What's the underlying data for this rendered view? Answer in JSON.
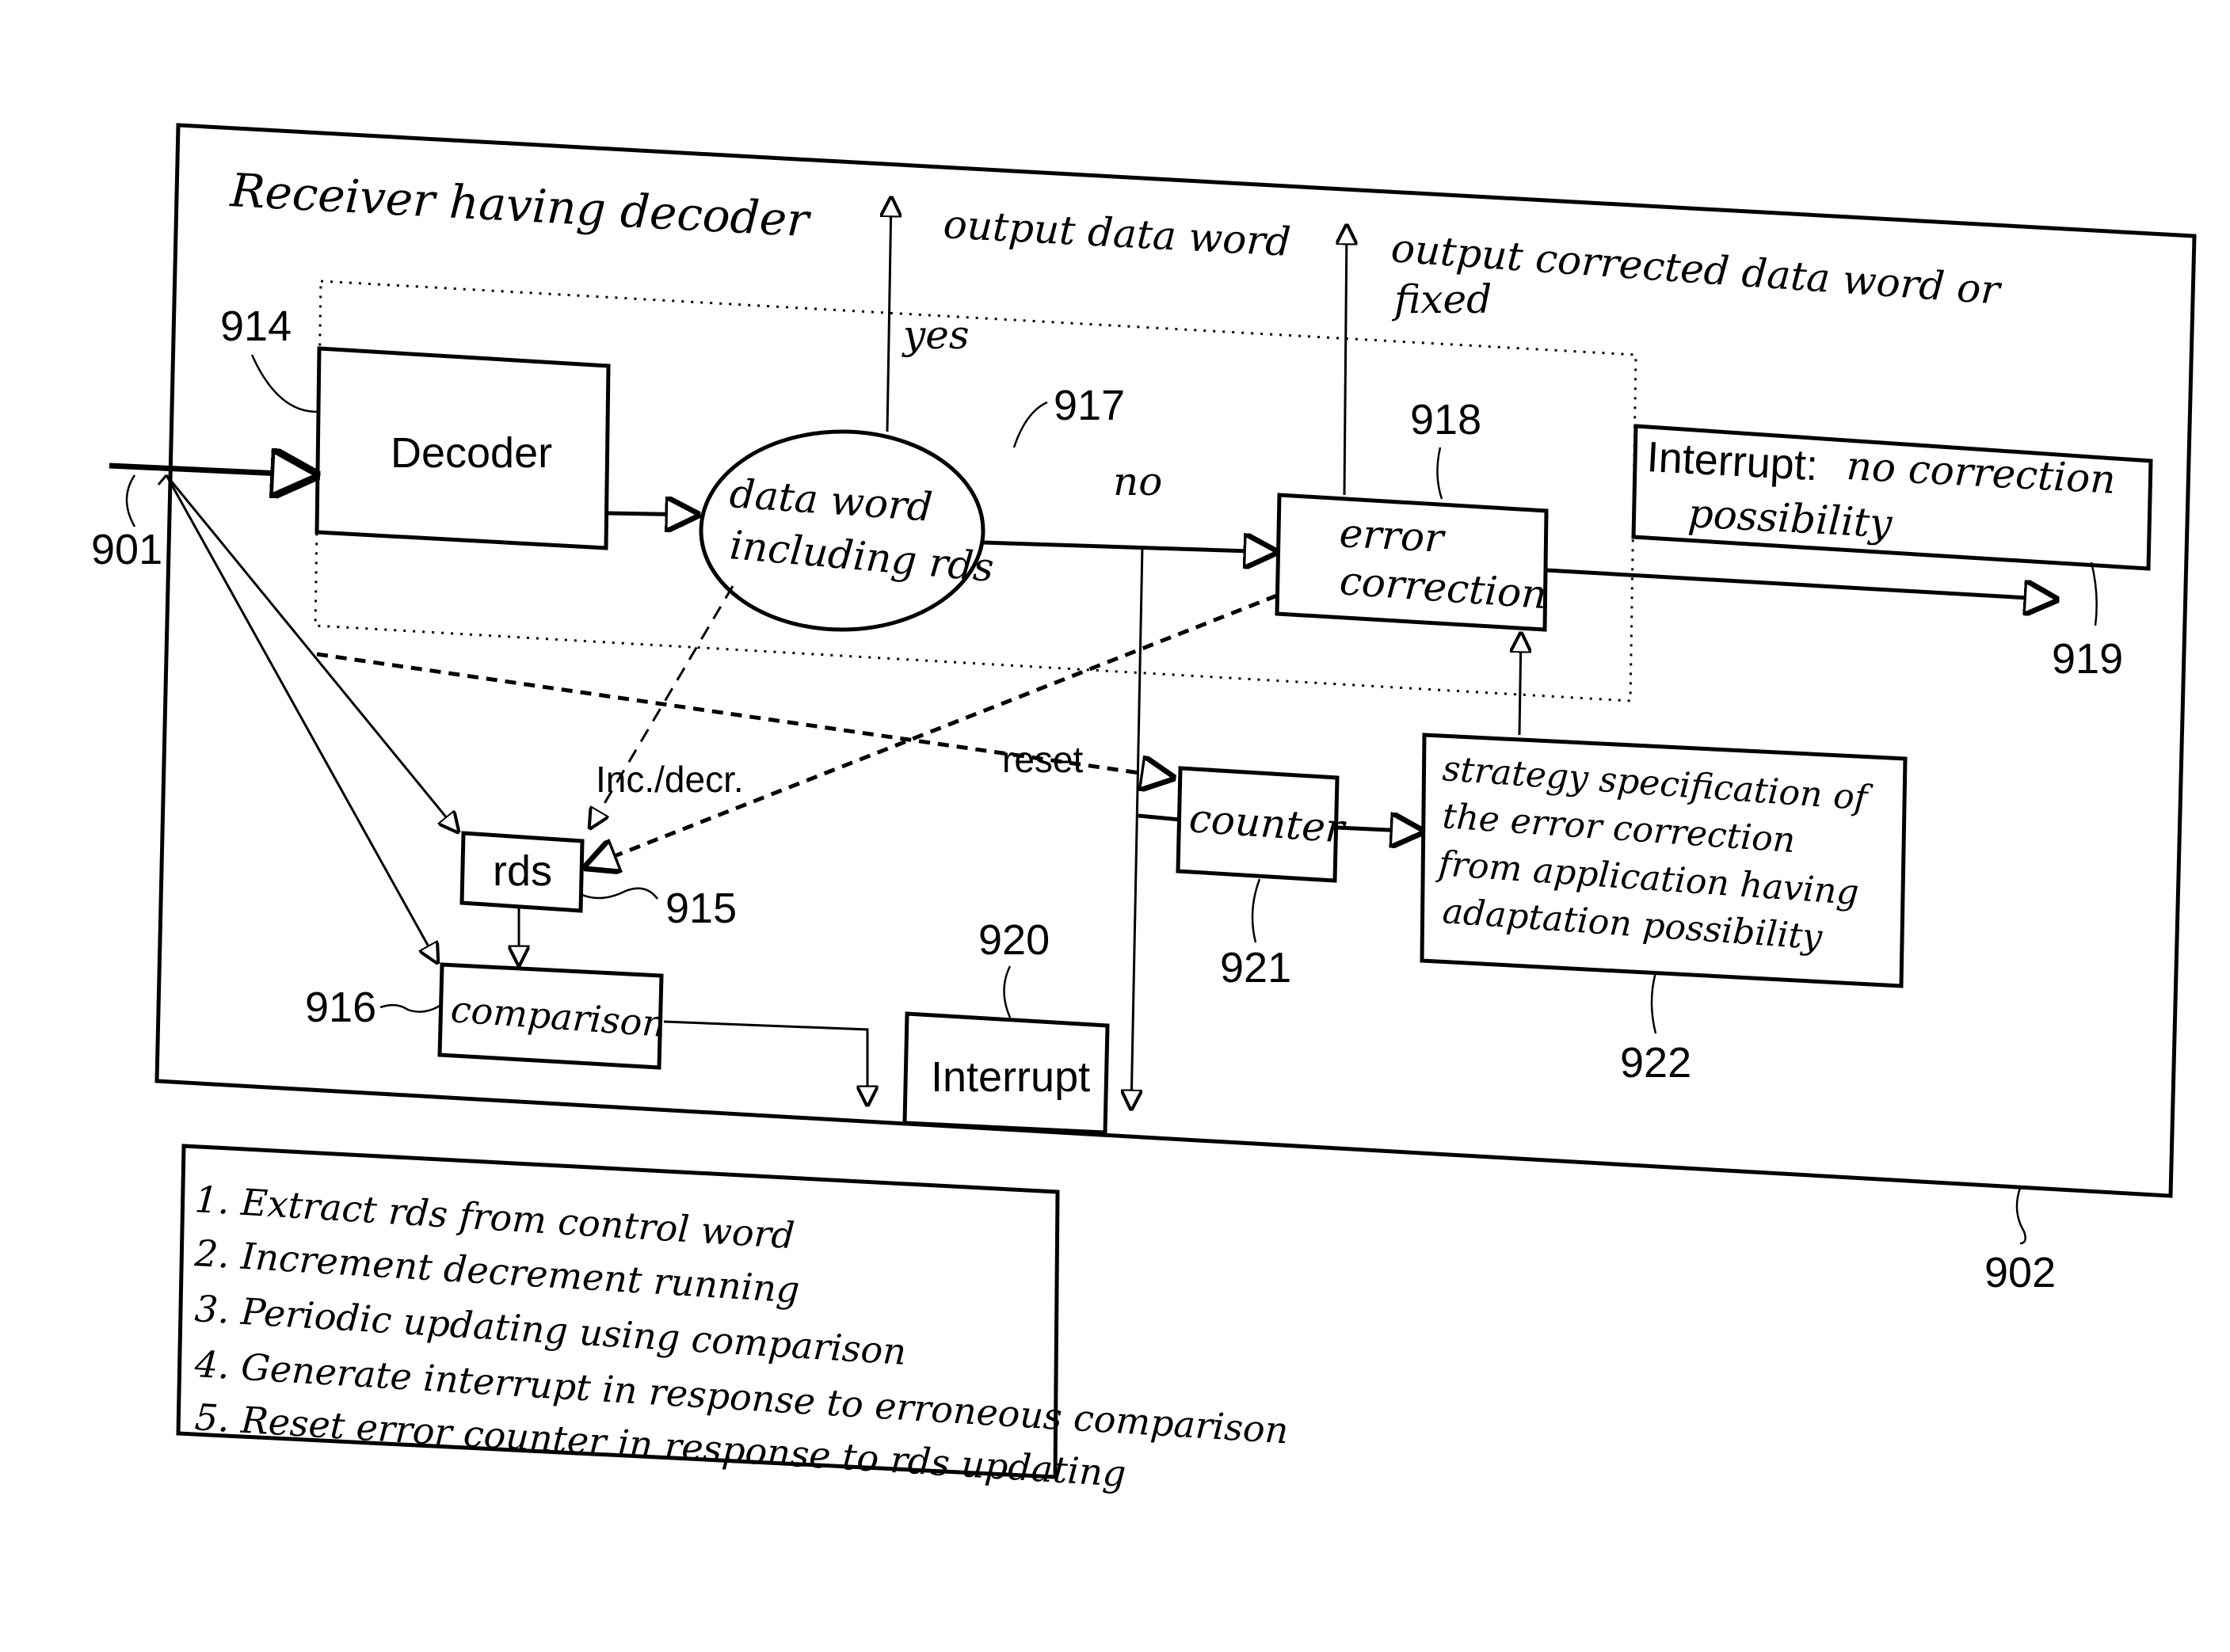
{
  "diagram": {
    "outer_title": "Receiver having decoder",
    "refs": {
      "input": "901",
      "receiver": "902",
      "decoder": "914",
      "rds": "915",
      "comparison": "916",
      "decision": "917",
      "error_correction": "918",
      "interrupt_no_correction": "919",
      "interrupt": "920",
      "counter": "921",
      "strategy": "922"
    },
    "nodes": {
      "decoder": "Decoder",
      "decision_line1": "data word",
      "decision_line2": "including rds",
      "error_correction_line1": "error",
      "error_correction_line2": "correction",
      "interrupt_no_correction_line1_prefix": "Interrupt:",
      "interrupt_no_correction_line1_suffix": "no correction",
      "interrupt_no_correction_line2": "possibility",
      "rds": "rds",
      "comparison": "comparison",
      "interrupt": "Interrupt",
      "counter": "counter",
      "strategy_lines": [
        "strategy specification of",
        "the error correction",
        "from application having",
        "adaptation possibility"
      ]
    },
    "edge_labels": {
      "yes": "yes",
      "no": "no",
      "output_data_word": "output data word",
      "output_corrected_line1": "output corrected data word or",
      "output_corrected_line2": "fixed",
      "inc_decr": "Inc./decr.",
      "reset": "reset"
    },
    "steps": [
      "1. Extract rds from control word",
      "2. Increment decrement running",
      "3. Periodic updating using comparison",
      "4. Generate interrupt in response to erroneous comparison",
      "5. Reset error counter in response to rds updating"
    ]
  }
}
